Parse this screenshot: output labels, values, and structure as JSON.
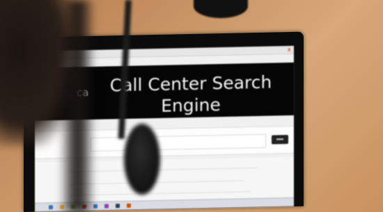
{
  "screen": {
    "logo_fragment": "ca",
    "title": "Call Center Search Engine",
    "window_close_glyph": "x"
  },
  "colors": {
    "header_band": "#050505",
    "screen_background": "#f0f0f0",
    "desk": "#c99565",
    "close_button": "#c8302c"
  },
  "icons": {
    "search_button": "search-button-icon",
    "window_close": "close-icon"
  },
  "taskbar": {
    "icon_colors": [
      "#3d6fb5",
      "#e8a23a",
      "#6aa84f",
      "#c0392b",
      "#3d6fb5",
      "#8e44ad",
      "#2c3e50",
      "#d35400"
    ]
  }
}
